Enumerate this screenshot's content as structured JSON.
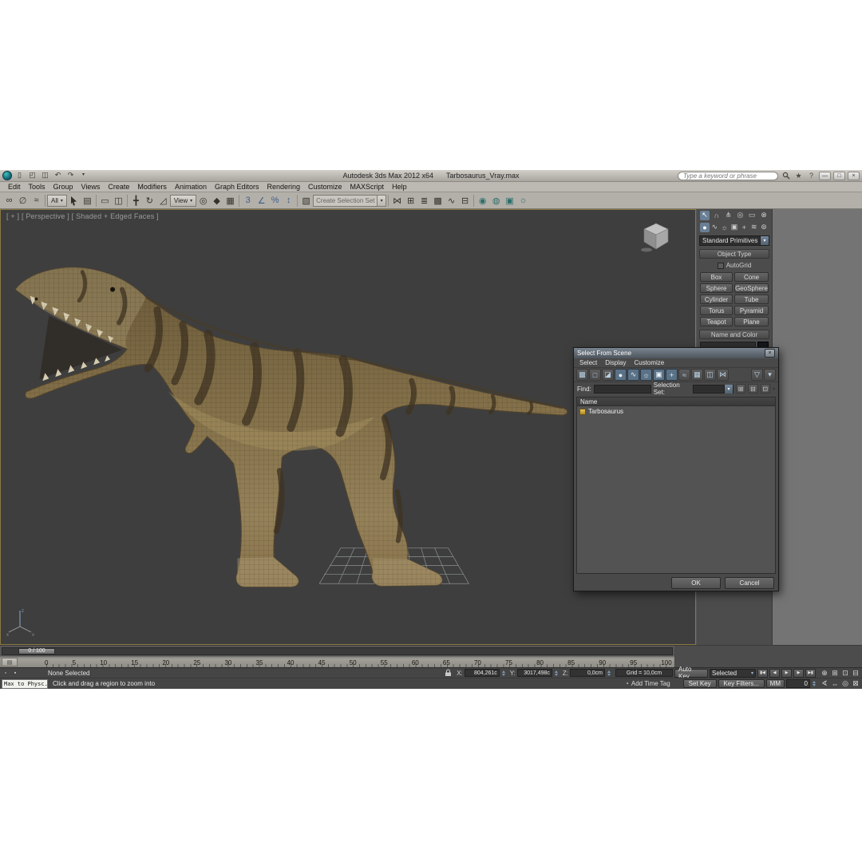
{
  "titlebar": {
    "app_title": "Autodesk 3ds Max 2012 x64",
    "doc_title": "Tarbosaurus_Vray.max",
    "search_placeholder": "Type a keyword or phrase"
  },
  "menus": [
    "Edit",
    "Tools",
    "Group",
    "Views",
    "Create",
    "Modifiers",
    "Animation",
    "Graph Editors",
    "Rendering",
    "Customize",
    "MAXScript",
    "Help"
  ],
  "toolbar": {
    "filter_value": "All",
    "coord_system_value": "View",
    "named_set_value": "Create Selection Set"
  },
  "viewport": {
    "label": "[ + ] [ Perspective ] [ Shaded + Edged Faces ]"
  },
  "command_panel": {
    "category_dropdown": "Standard Primitives",
    "object_type_rollout": "Object Type",
    "autogrid": "AutoGrid",
    "primitive_buttons": [
      "Box",
      "Cone",
      "Sphere",
      "GeoSphere",
      "Cylinder",
      "Tube",
      "Torus",
      "Pyramid",
      "Teapot",
      "Plane"
    ],
    "name_color_rollout": "Name and Color"
  },
  "dialog": {
    "title": "Select From Scene",
    "menus": [
      "Select",
      "Display",
      "Customize"
    ],
    "find_label": "Find:",
    "selection_set_label": "Selection Set:",
    "name_column": "Name",
    "rows": [
      {
        "name": "Tarbosaurus"
      }
    ],
    "ok_label": "OK",
    "cancel_label": "Cancel"
  },
  "timeline": {
    "slider_value": "0 / 100",
    "ticks": [
      "0",
      "5",
      "10",
      "15",
      "20",
      "25",
      "30",
      "35",
      "40",
      "45",
      "50",
      "55",
      "60",
      "65",
      "70",
      "75",
      "80",
      "85",
      "90",
      "95",
      "100"
    ]
  },
  "status": {
    "selection_info": "None Selected",
    "x_label": "X:",
    "x_value": "804,261c",
    "y_label": "Y:",
    "y_value": "3017,498c",
    "z_label": "Z:",
    "z_value": "0,0cm",
    "grid_info": "Grid = 10,0cm",
    "auto_key": "Auto Key",
    "set_key": "Set Key",
    "selection_set_dropdown": "Selected",
    "key_filters": "Key Filters...",
    "key_mode": "MM",
    "frame_value": "0",
    "listener_text": "Max to Physc.",
    "prompt": "Click and drag a region to zoom into",
    "add_time_tag": "Add Time Tag"
  },
  "colors": {
    "viewport_background": "#3e3e3e",
    "active_viewport_border": "#8a7840",
    "model_base": "#84714a",
    "model_stripe": "#3f3322"
  },
  "icons": {
    "new": "▯",
    "open": "◰",
    "save": "◫",
    "undo": "↶",
    "redo": "↷",
    "caret": "▾",
    "star": "★",
    "help": "?",
    "minimize": "—",
    "restore": "□",
    "close": "×",
    "link": "∞",
    "unlink": "∅",
    "bind": "≈",
    "by_name": "▤",
    "rect": "▭",
    "crossing": "◫",
    "move": "╋",
    "rotate": "↻",
    "scale": "◿",
    "pivot": "◎",
    "manipulate": "◆",
    "keyboard": "▦",
    "snap3": "3",
    "angle": "∠",
    "percent": "%",
    "spinner": "↕",
    "named_sets": "▧",
    "mirror": "⋈",
    "align": "⊞",
    "layers": "≣",
    "graphite": "▩",
    "curve": "∿",
    "schematic": "⊟",
    "material": "◉",
    "render_setup": "◍",
    "rfw": "▣",
    "render": "☼",
    "tab_create": "↖",
    "tab_modify": "∩",
    "tab_hier": "⋔",
    "tab_motion": "◎",
    "tab_display": "▭",
    "tab_util": "⊗",
    "cat_geo": "●",
    "cat_shapes": "∿",
    "cat_lights": "☼",
    "cat_cams": "▣",
    "cat_helpers": "+",
    "cat_warps": "≋",
    "cat_systems": "⊚",
    "sel_all": "▩",
    "sel_none": "□",
    "sel_invert": "◪",
    "d_geo": "●",
    "d_shapes": "∿",
    "d_lights": "☼",
    "d_cams": "▣",
    "d_helpers": "+",
    "d_warps": "≈",
    "d_groups": "▦",
    "d_xrefs": "◫",
    "d_bones": "⋈",
    "funnel": "▽",
    "add_set": "⊞",
    "sub_set": "⊟",
    "sel_set": "⊡",
    "mini1": "▫",
    "mini2": "▪",
    "t_start": "▮◀",
    "t_prev": "◀",
    "t_play": "▶",
    "t_next": "▶",
    "t_end": "▶▮",
    "zoom": "⊕",
    "zoom_all": "⊞",
    "zoom_ext": "⊡",
    "zoom_region": "⊟",
    "fov": "∢",
    "pan": "⇔",
    "orbit": "◎",
    "maximize": "⊠",
    "tag": "◔",
    "ruler_btn": "▤",
    "lock": "🔒"
  }
}
